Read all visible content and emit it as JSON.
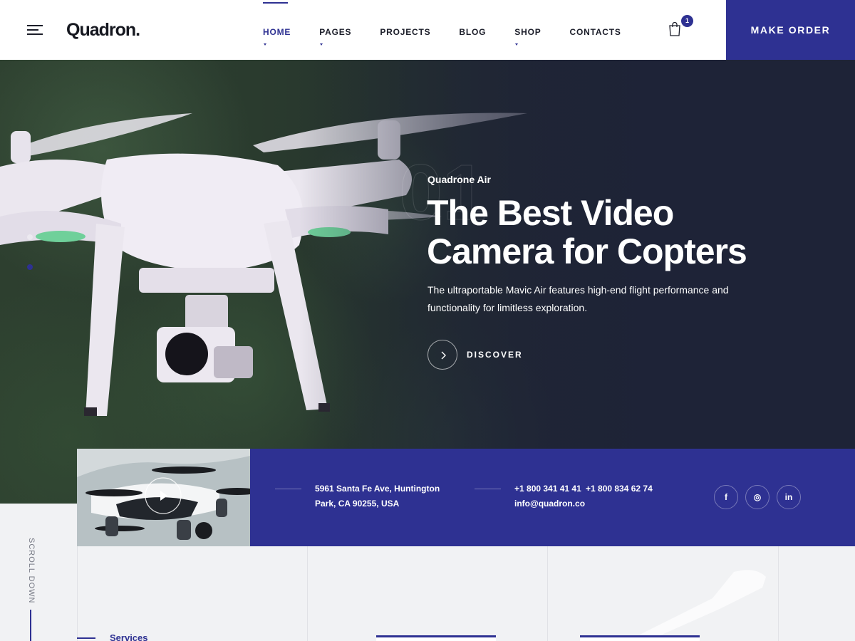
{
  "header": {
    "logo": "Quadron.",
    "nav": [
      {
        "label": "HOME",
        "active": true,
        "has_dropdown": true
      },
      {
        "label": "PAGES",
        "active": false,
        "has_dropdown": true
      },
      {
        "label": "PROJECTS",
        "active": false,
        "has_dropdown": false
      },
      {
        "label": "BLOG",
        "active": false,
        "has_dropdown": false
      },
      {
        "label": "SHOP",
        "active": false,
        "has_dropdown": true
      },
      {
        "label": "CONTACTS",
        "active": false,
        "has_dropdown": false
      }
    ],
    "cart_count": "1",
    "cta": "MAKE ORDER"
  },
  "hero": {
    "slide_number": "01",
    "kicker": "Quadrone Air",
    "title": "The Best Video Camera for Copters",
    "description": "The ultraportable Mavic Air features high-end flight performance and functionality for limitless exploration.",
    "cta": "DISCOVER",
    "active_slide": 2,
    "slide_count": 2
  },
  "info": {
    "address_line1": "5961 Santa Fe Ave, Huntington",
    "address_line2": "Park, CA 90255, USA",
    "phone1": "+1 800 341 41 41",
    "phone2": "+1 800 834 62 74",
    "email": "info@quadron.co",
    "social": [
      {
        "label": "f",
        "icon": "facebook-icon"
      },
      {
        "label": "◎",
        "icon": "instagram-icon"
      },
      {
        "label": "in",
        "icon": "linkedin-icon"
      }
    ]
  },
  "lower": {
    "scroll_label": "SCROLL DOWN",
    "section_label": "Services"
  },
  "colors": {
    "accent": "#2e3192",
    "dark": "#1b1d29",
    "light_bg": "#f1f2f4"
  }
}
